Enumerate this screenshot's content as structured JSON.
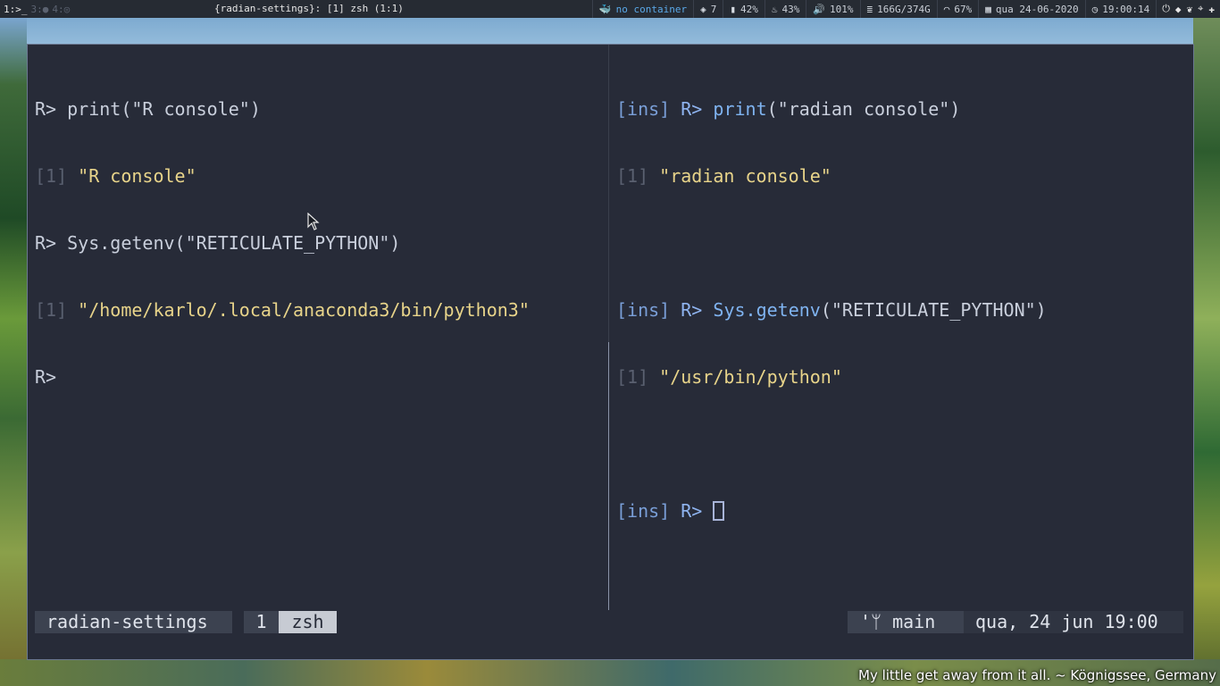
{
  "topbar": {
    "workspaces": [
      {
        "label": "1:",
        "icon": "terminal-icon",
        "active": true
      },
      {
        "label": "3:",
        "icon": "window-icon",
        "active": false
      },
      {
        "label": "4:",
        "icon": "globe-icon",
        "active": false
      }
    ],
    "window_title": "{radian-settings}: [1] zsh (1:1)",
    "docker": "no container",
    "packages": "7",
    "cpu": "42%",
    "temp": "43%",
    "volume": "101%",
    "disk": "166G/374G",
    "wifi": "67%",
    "date": "qua 24-06-2020",
    "time": "19:00:14"
  },
  "left_pane": {
    "prompt": "R>",
    "lines": [
      {
        "kind": "input",
        "prompt": "R>",
        "text": " print(\"R console\")"
      },
      {
        "kind": "output",
        "index": "[1]",
        "text": " \"R console\""
      },
      {
        "kind": "input",
        "prompt": "R>",
        "text": " Sys.getenv(\"RETICULATE_PYTHON\")"
      },
      {
        "kind": "output",
        "index": "[1]",
        "text": " \"/home/karlo/.local/anaconda3/bin/python3\""
      }
    ],
    "last_prompt": "R>"
  },
  "right_pane": {
    "mode": "[ins]",
    "prompt": "R>",
    "cmd1_fn": "print",
    "cmd1_args": "(\"radian console\")",
    "out1_index": "[1]",
    "out1_text": "\"radian console\"",
    "cmd2_fn": "Sys.getenv",
    "cmd2_args": "(\"RETICULATE_PYTHON\")",
    "out2_index": "[1]",
    "out2_text": "\"/usr/bin/python\""
  },
  "tmux": {
    "session": "radian-settings",
    "window_index": "1",
    "window_name": "zsh",
    "branch_icon": "git-branch-icon",
    "branch": "main",
    "clock": "qua, 24 jun 19:00"
  },
  "wallpaper_caption": "My little get away from it all. ~ Kögnigssee, Germany",
  "colors": {
    "background": "#272b38",
    "string": "#e8d48a",
    "function": "#7fb3f0",
    "mode": "#7a9fd8"
  }
}
